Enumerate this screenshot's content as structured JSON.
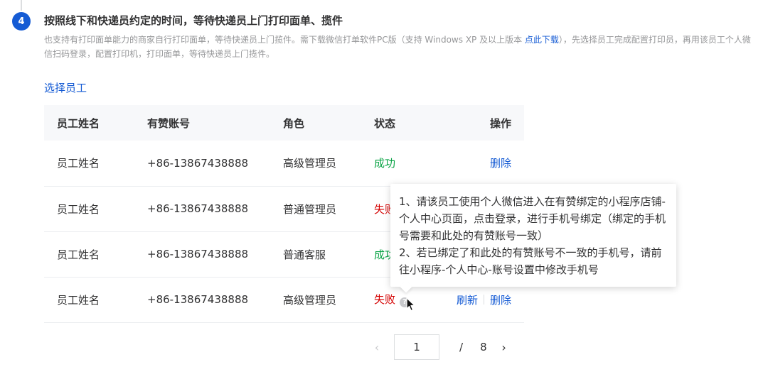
{
  "step": {
    "number": "4",
    "title": "按照线下和快递员约定的时间，等待快递员上门打印面单、揽件",
    "desc_before_link": "也支持有打印面单能力的商家自行打印面单，等待快递员上门揽件。需下载微信打单软件PC版（支持 Windows XP 及以上版本 ",
    "desc_link": "点此下载",
    "desc_after_link": "），先选择员工完成配置打印员，再用该员工个人微信扫码登录，配置打印机，打印面单，等待快递员上门揽件。"
  },
  "choose_staff": "选择员工",
  "table": {
    "headers": {
      "name": "员工姓名",
      "account": "有赞账号",
      "role": "角色",
      "status": "状态",
      "ops": "操作"
    },
    "rows": [
      {
        "name": "员工姓名",
        "account": "+86-13867438888",
        "role": "高级管理员",
        "status": "成功"
      },
      {
        "name": "员工姓名",
        "account": "+86-13867438888",
        "role": "普通管理员",
        "status": "失败"
      },
      {
        "name": "员工姓名",
        "account": "+86-13867438888",
        "role": "普通客服",
        "status": "成功"
      },
      {
        "name": "员工姓名",
        "account": "+86-13867438888",
        "role": "高级管理员",
        "status": "失败"
      }
    ],
    "op_delete": "删除",
    "op_refresh": "刷新"
  },
  "tooltip": {
    "line1": "1、请该员工使用个人微信进入在有赞绑定的小程序店铺-个人中心页面，点击登录，进行手机号绑定（绑定的手机号需要和此处的有赞账号一致）",
    "line2": "2、若已绑定了和此处的有赞账号不一致的手机号，请前往小程序-个人中心-账号设置中修改手机号"
  },
  "pager": {
    "prev": "‹",
    "current": "1",
    "slash": "/",
    "total": "8",
    "next": "›"
  },
  "icons": {
    "help": "help-icon",
    "cursor": "mouse-cursor-icon"
  },
  "colors": {
    "accent": "#155bd4",
    "success": "#07a243",
    "fail": "#d40000"
  }
}
